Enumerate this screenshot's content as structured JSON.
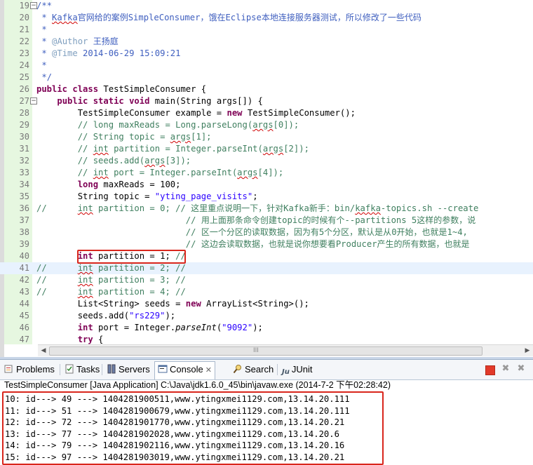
{
  "editor": {
    "lines": [
      {
        "n": "19",
        "fold": "−",
        "html": "<span class=\"jd\">/**</span>"
      },
      {
        "n": "20",
        "html": "<span class=\"jd\"> * <span class=\"sq\">Kafka</span><span class=\"zh\">官网给的案例</span>SimpleConsumer<span class=\"zh\">，饿在</span>Eclipse<span class=\"zh\">本地连接服务器测试，所以修改了一些代码</span></span>"
      },
      {
        "n": "21",
        "html": "<span class=\"jd\"> *</span>"
      },
      {
        "n": "22",
        "html": "<span class=\"jd\"> * <span class=\"tag\">@Author</span> <span class=\"zh\">王扬庭</span></span>"
      },
      {
        "n": "23",
        "html": "<span class=\"jd\"> * <span class=\"tag\">@Time</span> 2014-06-29 15:09:21</span>"
      },
      {
        "n": "24",
        "html": "<span class=\"jd\"> *</span>"
      },
      {
        "n": "25",
        "html": "<span class=\"jd\"> */</span>"
      },
      {
        "n": "26",
        "html": "<span class=\"kw\">public class</span> TestSimpleConsumer {"
      },
      {
        "n": "27",
        "fold": "−",
        "html": "    <span class=\"kw\">public static void</span> main(String args[]) {"
      },
      {
        "n": "28",
        "html": "        TestSimpleConsumer example = <span class=\"kw\">new</span> TestSimpleConsumer();"
      },
      {
        "n": "29",
        "html": "        <span class=\"cm\">// long maxReads = Long.parseLong(<span class=\"sq\">args</span>[0]);</span>"
      },
      {
        "n": "30",
        "html": "        <span class=\"cm\">// String topic = <span class=\"sq\">args</span>[1];</span>"
      },
      {
        "n": "31",
        "html": "        <span class=\"cm\">// <span class=\"sq\">int</span> partition = Integer.parseInt(<span class=\"sq\">args</span>[2]);</span>"
      },
      {
        "n": "32",
        "html": "        <span class=\"cm\">// seeds.add(<span class=\"sq\">args</span>[3]);</span>"
      },
      {
        "n": "33",
        "html": "        <span class=\"cm\">// <span class=\"sq\">int</span> port = Integer.parseInt(<span class=\"sq\">args</span>[4]);</span>"
      },
      {
        "n": "34",
        "html": "        <span class=\"kw\">long</span> maxReads = 100;"
      },
      {
        "n": "35",
        "html": "        String topic = <span class=\"str\">\"yting_page_visits\"</span>;"
      },
      {
        "n": "36",
        "html": "<span class=\"cm\">//      <span class=\"sq\">int</span> partition = 0; // <span class=\"zh\">这里重点说明一下，针对</span>Kafka<span class=\"zh\">新手：</span>bin/<span class=\"sq\">kafka</span>-topics.sh --create</span>"
      },
      {
        "n": "37",
        "html": "<span class=\"cm\">                             // <span class=\"zh\">用上面那条命令创建</span>topic<span class=\"zh\">的时候有个</span>--partitions 5<span class=\"zh\">这样的参数，说</span></span>"
      },
      {
        "n": "38",
        "html": "<span class=\"cm\">                             // <span class=\"zh\">区一个分区的读取数据，因为有</span>5<span class=\"zh\">个分区，默认是从</span>0<span class=\"zh\">开始，也就是</span>1~4,</span>"
      },
      {
        "n": "39",
        "html": "<span class=\"cm\">                             // <span class=\"zh\">这边会读取数据，也就是说你想要看</span>Producer<span class=\"zh\">产生的所有数据，也就是</span></span>"
      },
      {
        "n": "40",
        "html": "        <span class=\"kw\">int</span> partition = 1; <span class=\"cm\">//</span>"
      },
      {
        "n": "41",
        "current": true,
        "html": "<span class=\"cm\">//      <span class=\"sq\">int</span> partition = 2; //</span>"
      },
      {
        "n": "42",
        "html": "<span class=\"cm\">//      <span class=\"sq\">int</span> partition = 3; //</span>"
      },
      {
        "n": "43",
        "html": "<span class=\"cm\">//      <span class=\"sq\">int</span> partition = 4; //</span>"
      },
      {
        "n": "44",
        "html": "        List&lt;String&gt; seeds = <span class=\"kw\">new</span> ArrayList&lt;String&gt;();"
      },
      {
        "n": "45",
        "html": "        seeds.add(<span class=\"str\">\"rs229\"</span>);"
      },
      {
        "n": "46",
        "html": "        <span class=\"kw\">int</span> port = Integer.<span class=\"it\">parseInt</span>(<span class=\"str\">\"9092\"</span>);"
      },
      {
        "n": "47",
        "html": "        <span class=\"kw\">try</span> {"
      }
    ]
  },
  "tabs": [
    {
      "label": "Problems",
      "name": "tab-problems",
      "icon": "problems-icon"
    },
    {
      "label": "Tasks",
      "name": "tab-tasks",
      "icon": "tasks-icon"
    },
    {
      "label": "Servers",
      "name": "tab-servers",
      "icon": "servers-icon"
    },
    {
      "label": "Console",
      "name": "tab-console",
      "icon": "console-icon",
      "active": true,
      "close": "✕"
    },
    {
      "label": "Search",
      "name": "tab-search",
      "icon": "search-icon"
    },
    {
      "label": "JUnit",
      "name": "tab-junit",
      "icon": "junit-icon",
      "icon_text": "Ju"
    }
  ],
  "console": {
    "launch_label": "TestSimpleConsumer [Java Application] C:\\Java\\jdk1.6.0_45\\bin\\javaw.exe (2014-7-2 下午02:28:42)",
    "lines": [
      "10: id---> 49 ---> 1404281900511,www.ytingxmei1129.com,13.14.20.111",
      "11: id---> 51 ---> 1404281900679,www.ytingxmei1129.com,13.14.20.111",
      "12: id---> 72 ---> 1404281901770,www.ytingxmei1129.com,13.14.20.21",
      "13: id---> 77 ---> 1404281902028,www.ytingxmei1129.com,13.14.20.6",
      "14: id---> 79 ---> 1404281902116,www.ytingxmei1129.com,13.14.20.16",
      "15: id---> 97 ---> 1404281903019,www.ytingxmei1129.com,13.14.20.21"
    ]
  },
  "scrollbar": {
    "grip": "III"
  },
  "colors": {
    "highlight_box": "#d9261c",
    "keyword": "#7f0055",
    "string": "#2a00ff",
    "comment": "#3f7f5f",
    "javadoc": "#3f5fbf"
  }
}
